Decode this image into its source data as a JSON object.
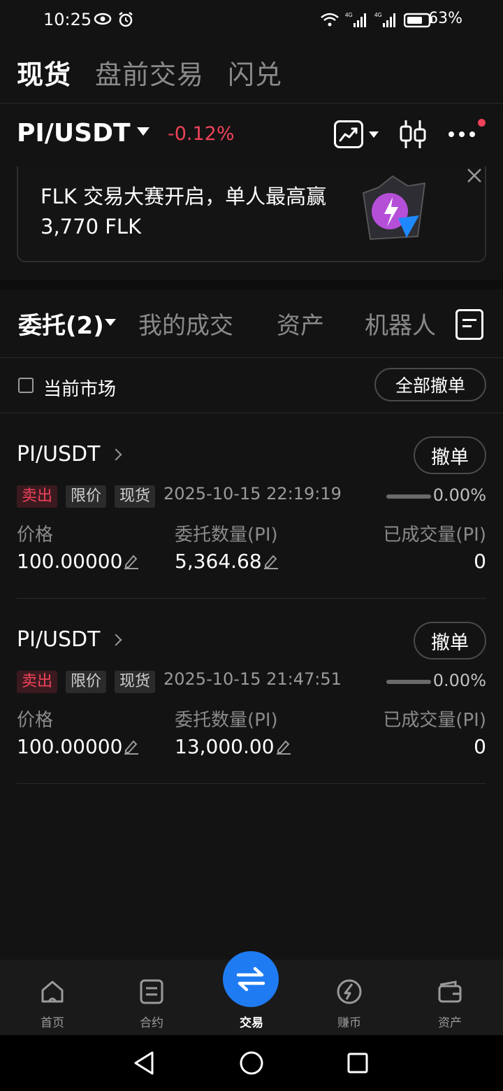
{
  "status_bar": {
    "time": "10:25",
    "battery": "63%",
    "network1": "4G",
    "network2": "4G"
  },
  "top_tabs": [
    "现货",
    "盘前交易",
    "闪兑"
  ],
  "pair": {
    "name": "PI/USDT",
    "change": "-0.12%"
  },
  "banner": {
    "text": "FLK 交易大赛开启，单人最高赢 3,770 FLK"
  },
  "order_tabs": {
    "orders": "委托(2)",
    "trades": "我的成交",
    "assets": "资产",
    "bots": "机器人"
  },
  "filter": {
    "current_market": "当前市场",
    "cancel_all": "全部撤单"
  },
  "orders": [
    {
      "pair": "PI/USDT",
      "cancel": "撤单",
      "side": "卖出",
      "type": "限价",
      "market": "现货",
      "time": "2025-10-15 22:19:19",
      "filled_pct": "0.00%",
      "price_label": "价格",
      "price": "100.00000",
      "qty_label": "委托数量(PI)",
      "qty": "5,364.68",
      "filled_label": "已成交量(PI)",
      "filled": "0"
    },
    {
      "pair": "PI/USDT",
      "cancel": "撤单",
      "side": "卖出",
      "type": "限价",
      "market": "现货",
      "time": "2025-10-15 21:47:51",
      "filled_pct": "0.00%",
      "price_label": "价格",
      "price": "100.00000",
      "qty_label": "委托数量(PI)",
      "qty": "13,000.00",
      "filled_label": "已成交量(PI)",
      "filled": "0"
    }
  ],
  "bottom_nav": {
    "home": "首页",
    "futures": "合约",
    "trade": "交易",
    "earn": "赚币",
    "assets": "资产"
  },
  "colors": {
    "accent": "#1f7bf2",
    "sell": "#f0425b",
    "background": "#131313"
  }
}
